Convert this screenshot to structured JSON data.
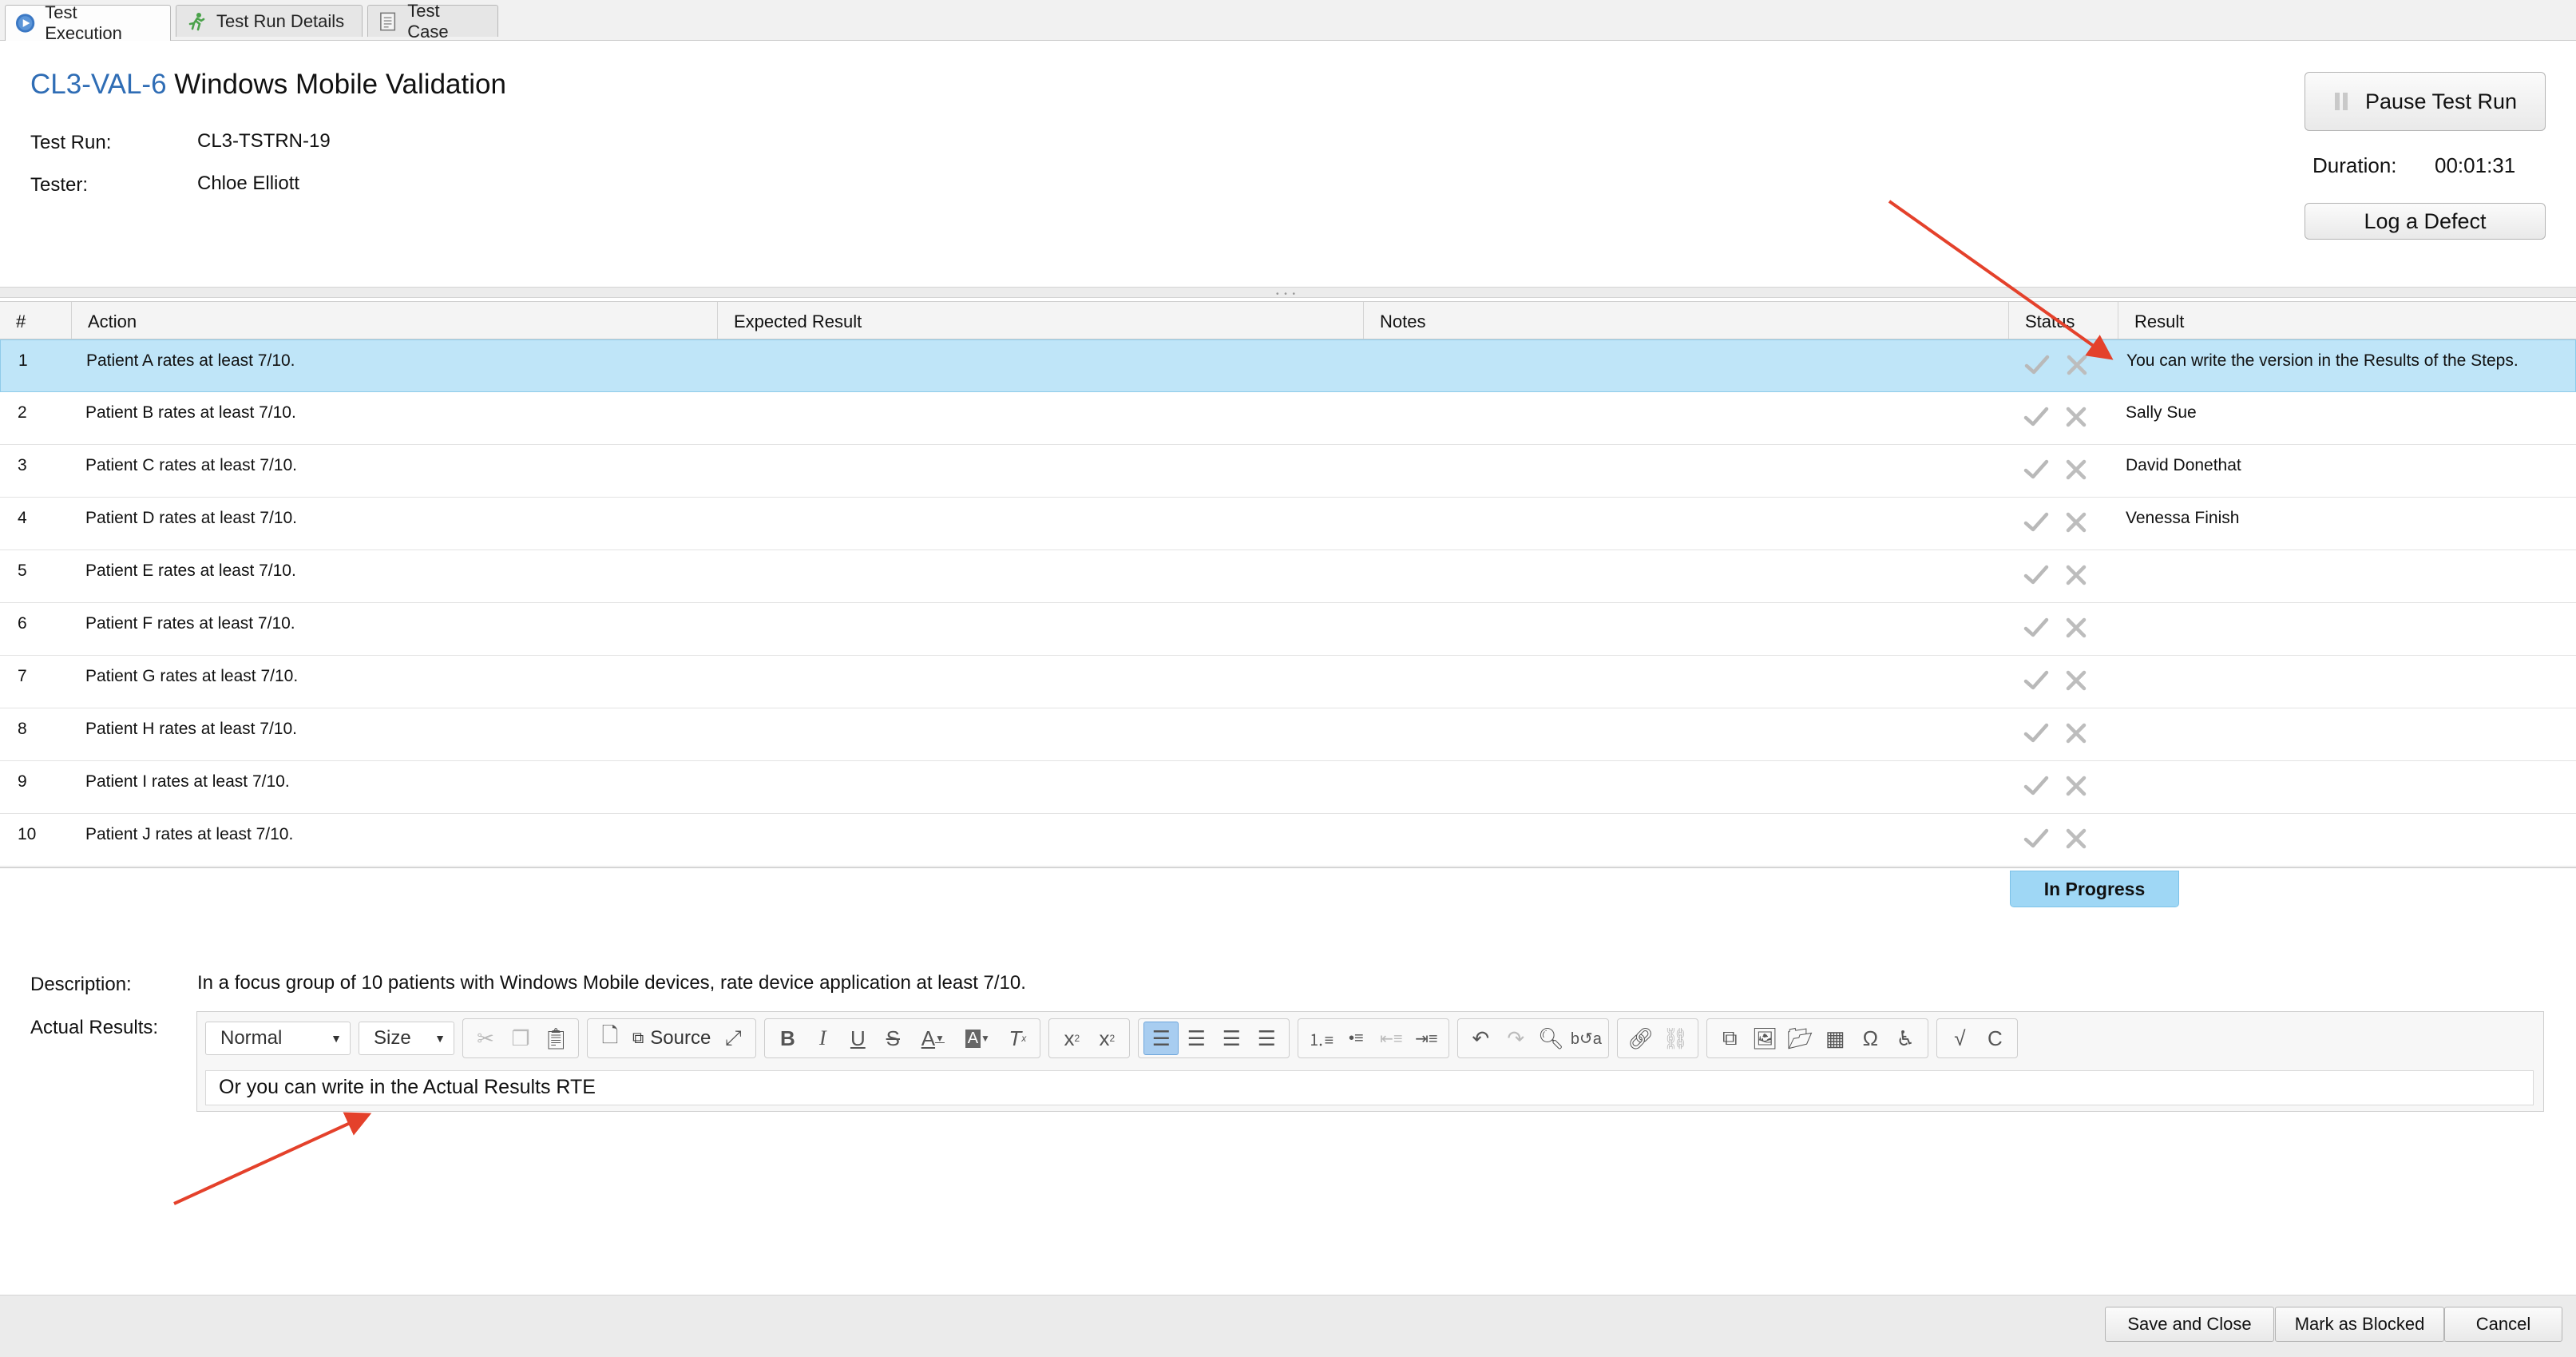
{
  "tabs": [
    {
      "label": "Test Execution",
      "icon": "play-circle-icon",
      "active": true
    },
    {
      "label": "Test Run Details",
      "icon": "running-figure-icon",
      "active": false
    },
    {
      "label": "Test Case",
      "icon": "document-icon",
      "active": false
    }
  ],
  "header": {
    "key": "CL3-VAL-6",
    "title": "Windows Mobile Validation",
    "test_run_label": "Test Run:",
    "test_run_value": "CL3-TSTRN-19",
    "tester_label": "Tester:",
    "tester_value": "Chloe Elliott"
  },
  "actions": {
    "pause_label": "Pause Test Run",
    "duration_label": "Duration:",
    "duration_value": "00:01:31",
    "log_defect_label": "Log a Defect"
  },
  "grid": {
    "columns": [
      "#",
      "Action",
      "Expected Result",
      "Notes",
      "Status",
      "Result"
    ],
    "rows": [
      {
        "num": "1",
        "action": "Patient A rates at least 7/10.",
        "expected": "",
        "notes": "",
        "result": "You can write the version in the Results of the Steps.",
        "selected": true
      },
      {
        "num": "2",
        "action": "Patient B rates at least 7/10.",
        "expected": "",
        "notes": "",
        "result": "Sally Sue"
      },
      {
        "num": "3",
        "action": "Patient C rates at least 7/10.",
        "expected": "",
        "notes": "",
        "result": "David Donethat"
      },
      {
        "num": "4",
        "action": "Patient D rates at least 7/10.",
        "expected": "",
        "notes": "",
        "result": "Venessa Finish"
      },
      {
        "num": "5",
        "action": "Patient E rates at least 7/10.",
        "expected": "",
        "notes": "",
        "result": ""
      },
      {
        "num": "6",
        "action": "Patient F rates at least 7/10.",
        "expected": "",
        "notes": "",
        "result": ""
      },
      {
        "num": "7",
        "action": "Patient G rates at least 7/10.",
        "expected": "",
        "notes": "",
        "result": ""
      },
      {
        "num": "8",
        "action": "Patient H rates at least 7/10.",
        "expected": "",
        "notes": "",
        "result": ""
      },
      {
        "num": "9",
        "action": "Patient I rates at least 7/10.",
        "expected": "",
        "notes": "",
        "result": ""
      },
      {
        "num": "10",
        "action": "Patient J rates at least 7/10.",
        "expected": "",
        "notes": "",
        "result": ""
      }
    ],
    "status_text": "In Progress"
  },
  "details": {
    "description_label": "Description:",
    "description_value": "In a focus group of 10 patients with Windows Mobile devices, rate device application at least 7/10.",
    "actual_results_label": "Actual Results:"
  },
  "editor": {
    "format_value": "Normal",
    "size_value": "Size",
    "source_label": "Source",
    "content": "Or you can write in the Actual Results RTE"
  },
  "footer": {
    "save_close_label": "Save and Close",
    "mark_blocked_label": "Mark as Blocked",
    "cancel_label": "Cancel"
  },
  "colors": {
    "accent_key": "#2f6db5",
    "selected_row": "#bfe5f8",
    "status_badge": "#9fd7f5",
    "annotation_arrow": "#e4412b"
  }
}
